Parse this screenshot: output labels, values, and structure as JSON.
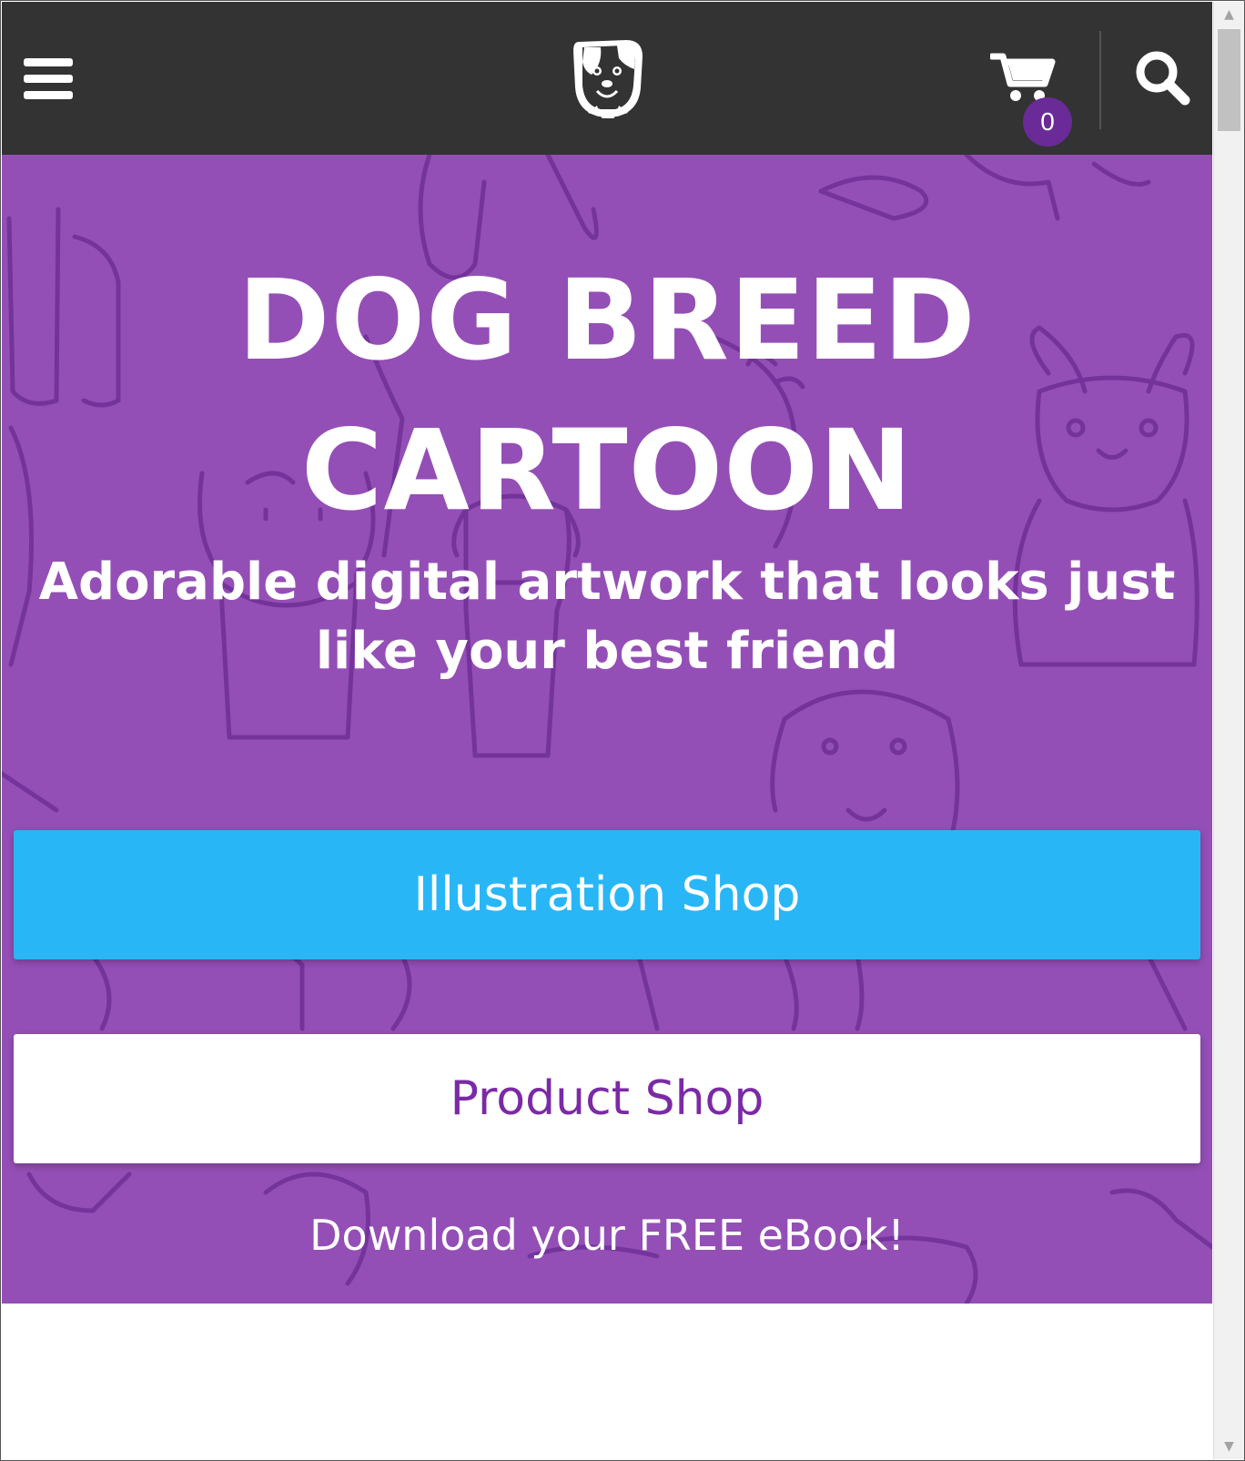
{
  "header": {
    "menu_icon": "hamburger-menu-icon",
    "logo_icon": "dog-face-logo-icon",
    "cart_icon": "shopping-cart-icon",
    "cart_count": "0",
    "search_icon": "magnifier-search-icon"
  },
  "hero": {
    "title_line1": "DOG BREED",
    "title_line2": "CARTOON",
    "subtitle": "Adorable digital artwork that looks just like your best friend",
    "illustration_shop_label": "Illustration Shop",
    "product_shop_label": "Product Shop",
    "ebook_link": "Download your FREE eBook!"
  },
  "colors": {
    "header_bg": "#333333",
    "hero_bg": "#944fb6",
    "pattern_stroke": "#6f2f96",
    "illustration_button": "#29b6f6",
    "product_button_text": "#7b2aa6",
    "cart_badge": "#6a2a98"
  }
}
